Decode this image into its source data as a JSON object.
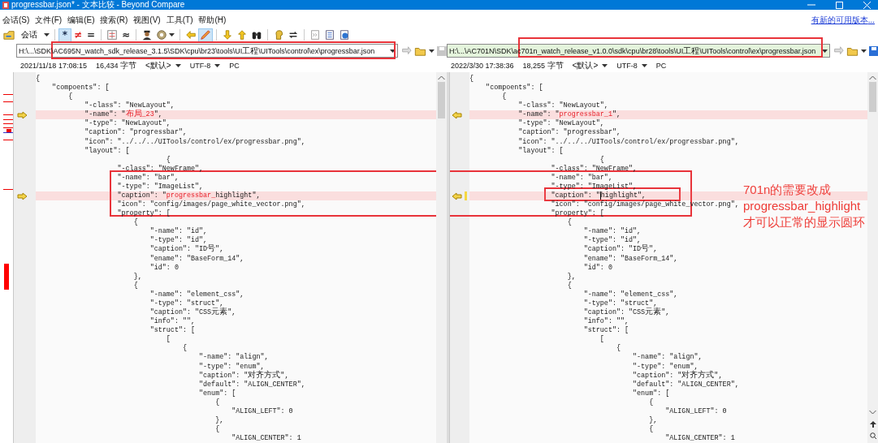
{
  "window": {
    "title": "progressbar.json* - 文本比较 - Beyond Compare"
  },
  "menu": [
    "会话(S)",
    "文件(F)",
    "编辑(E)",
    "搜索(R)",
    "视图(V)",
    "工具(T)",
    "帮助(H)"
  ],
  "update_link": "有新的可用版本...",
  "toolbar": {
    "groups": [
      [
        {
          "kind": "session",
          "label": "会话",
          "pressed": false
        }
      ],
      [
        {
          "kind": "glyph",
          "glyph": "*",
          "color": "#1a2a4a",
          "pressed": true
        },
        {
          "kind": "glyph",
          "glyph": "≠",
          "color": "#e02020",
          "pressed": false
        },
        {
          "kind": "glyph",
          "glyph": "=",
          "color": "#222222",
          "pressed": false
        }
      ],
      [
        {
          "kind": "icon",
          "pressed": false
        },
        {
          "kind": "glyph",
          "glyph": "≈",
          "color": "#222222",
          "pressed": false
        }
      ],
      [
        {
          "kind": "icon",
          "pressed": false
        },
        {
          "kind": "icon",
          "pressed": false
        }
      ],
      [
        {
          "kind": "icon",
          "pressed": false
        },
        {
          "kind": "icon",
          "pressed": true
        }
      ],
      [
        {
          "kind": "icon",
          "pressed": false
        },
        {
          "kind": "icon",
          "pressed": false
        },
        {
          "kind": "icon",
          "pressed": false
        }
      ],
      [
        {
          "kind": "icon",
          "pressed": false
        },
        {
          "kind": "icon",
          "pressed": false
        }
      ],
      [
        {
          "kind": "icon",
          "pressed": false
        },
        {
          "kind": "icon",
          "pressed": false
        },
        {
          "kind": "icon",
          "pressed": false
        }
      ]
    ]
  },
  "panes": [
    {
      "path": "H:\\...\\SDK\\AC695N_watch_sdk_release_3.1.5\\SDK\\cpu\\br23\\tools\\UI工程\\UITools\\control\\ex\\progressbar.json",
      "color": "#ffffff",
      "save_enabled": false,
      "modified": "2021/11/18 17:08:15",
      "size": "16,434 字节",
      "profile": "<默认>",
      "encoding": "UTF-8",
      "line_ending": "PC",
      "lines": [
        {
          "text": "{",
          "differs": false,
          "current": false
        },
        {
          "text": "    \"compoents\": [",
          "differs": false,
          "current": false
        },
        {
          "text": "        {",
          "differs": false,
          "current": false
        },
        {
          "text": "            \"-class\": \"NewLayout\",",
          "differs": false,
          "current": false
        },
        {
          "text": "            \"-name\": \"",
          "changed": "布局_23",
          "after": "\",",
          "differs": true,
          "current": false
        },
        {
          "text": "            \"-type\": \"NewLayout\",",
          "differs": false,
          "current": false
        },
        {
          "text": "            \"caption\": \"progressbar\",",
          "differs": false,
          "current": false
        },
        {
          "text": "            \"icon\": \"../../../UITools/control/ex/progressbar.png\",",
          "differs": false,
          "current": false
        },
        {
          "text": "            \"layout\": [",
          "differs": false,
          "current": false
        },
        {
          "text": "                                {",
          "differs": false,
          "current": false
        },
        {
          "text": "                    \"-class\": \"NewFrame\",",
          "differs": false,
          "current": false
        },
        {
          "text": "                    \"-name\": \"bar\",",
          "differs": false,
          "current": false
        },
        {
          "text": "                    \"-type\": \"ImageList\",",
          "differs": false,
          "current": false
        },
        {
          "text": "                    \"caption\": \"",
          "changed": "progressbar_",
          "after": "highlight\",",
          "differs": true,
          "current": false
        },
        {
          "text": "                    \"icon\": \"config/images/page_white_vector.png\",",
          "differs": false,
          "current": false
        },
        {
          "text": "                    \"property\": [",
          "differs": false,
          "current": false
        },
        {
          "text": "                        {",
          "differs": false,
          "current": false
        },
        {
          "text": "                            \"-name\": \"id\",",
          "differs": false,
          "current": false
        },
        {
          "text": "                            \"-type\": \"id\",",
          "differs": false,
          "current": false
        },
        {
          "text": "                            \"caption\": \"ID号\",",
          "differs": false,
          "current": false
        },
        {
          "text": "                            \"ename\": \"BaseForm_14\",",
          "differs": false,
          "current": false
        },
        {
          "text": "                            \"id\": 0",
          "differs": false,
          "current": false
        },
        {
          "text": "                        },",
          "differs": false,
          "current": false
        },
        {
          "text": "                        {",
          "differs": false,
          "current": false
        },
        {
          "text": "                            \"-name\": \"element_css\",",
          "differs": false,
          "current": false
        },
        {
          "text": "                            \"-type\": \"struct\",",
          "differs": false,
          "current": false
        },
        {
          "text": "                            \"caption\": \"CSS元素\",",
          "differs": false,
          "current": false
        },
        {
          "text": "                            \"info\": \"\",",
          "differs": false,
          "current": false
        },
        {
          "text": "                            \"struct\": [",
          "differs": false,
          "current": false
        },
        {
          "text": "                                [",
          "differs": false,
          "current": false
        },
        {
          "text": "                                    {",
          "differs": false,
          "current": false
        },
        {
          "text": "                                        \"-name\": \"align\",",
          "differs": false,
          "current": false
        },
        {
          "text": "                                        \"-type\": \"enum\",",
          "differs": false,
          "current": false
        },
        {
          "text": "                                        \"caption\": \"对齐方式\",",
          "differs": false,
          "current": false
        },
        {
          "text": "                                        \"default\": \"ALIGN_CENTER\",",
          "differs": false,
          "current": false
        },
        {
          "text": "                                        \"enum\": [",
          "differs": false,
          "current": false
        },
        {
          "text": "                                            {",
          "differs": false,
          "current": false
        },
        {
          "text": "                                                \"ALIGN_LEFT\": 0",
          "differs": false,
          "current": false
        },
        {
          "text": "                                            },",
          "differs": false,
          "current": false
        },
        {
          "text": "                                            {",
          "differs": false,
          "current": false
        },
        {
          "text": "                                                \"ALIGN_CENTER\": 1",
          "differs": false,
          "current": false
        }
      ]
    },
    {
      "path": "H:\\...\\AC701N\\SDK\\ac701n_watch_release_v1.0.0\\sdk\\cpu\\br28\\tools\\UI工程\\UITools\\control\\ex\\progressbar.json",
      "color": "#e4f4dc",
      "save_enabled": true,
      "modified": "2022/3/30 17:38:36",
      "size": "18,255 字节",
      "profile": "<默认>",
      "encoding": "UTF-8",
      "line_ending": "PC",
      "lines": [
        {
          "text": "{",
          "differs": false,
          "current": false
        },
        {
          "text": "    \"compoents\": [",
          "differs": false,
          "current": false
        },
        {
          "text": "        {",
          "differs": false,
          "current": false
        },
        {
          "text": "            \"-class\": \"NewLayout\",",
          "differs": false,
          "current": false
        },
        {
          "text": "            \"-name\": \"",
          "changed": "progressbar_1",
          "after": "\",",
          "differs": true,
          "current": false
        },
        {
          "text": "            \"-type\": \"NewLayout\",",
          "differs": false,
          "current": false
        },
        {
          "text": "            \"caption\": \"progressbar\",",
          "differs": false,
          "current": false
        },
        {
          "text": "            \"icon\": \"../../../UITools/control/ex/progressbar.png\",",
          "differs": false,
          "current": false
        },
        {
          "text": "            \"layout\": [",
          "differs": false,
          "current": false
        },
        {
          "text": "                                {",
          "differs": false,
          "current": false
        },
        {
          "text": "                    \"-class\": \"NewFrame\",",
          "differs": false,
          "current": false
        },
        {
          "text": "                    \"-name\": \"bar\",",
          "differs": false,
          "current": false
        },
        {
          "text": "                    \"-type\": \"ImageList\",",
          "differs": false,
          "current": false
        },
        {
          "text": "                    \"caption\": \"",
          "after": "highlight\",",
          "differs": true,
          "current": true
        },
        {
          "text": "                    \"icon\": \"config/images/page_white_vector.png\",",
          "differs": false,
          "current": false
        },
        {
          "text": "                    \"property\": [",
          "differs": false,
          "current": false
        },
        {
          "text": "                        {",
          "differs": false,
          "current": false
        },
        {
          "text": "                            \"-name\": \"id\",",
          "differs": false,
          "current": false
        },
        {
          "text": "                            \"-type\": \"id\",",
          "differs": false,
          "current": false
        },
        {
          "text": "                            \"caption\": \"ID号\",",
          "differs": false,
          "current": false
        },
        {
          "text": "                            \"ename\": \"BaseForm_14\",",
          "differs": false,
          "current": false
        },
        {
          "text": "                            \"id\": 0",
          "differs": false,
          "current": false
        },
        {
          "text": "                        },",
          "differs": false,
          "current": false
        },
        {
          "text": "                        {",
          "differs": false,
          "current": false
        },
        {
          "text": "                            \"-name\": \"element_css\",",
          "differs": false,
          "current": false
        },
        {
          "text": "                            \"-type\": \"struct\",",
          "differs": false,
          "current": false
        },
        {
          "text": "                            \"caption\": \"CSS元素\",",
          "differs": false,
          "current": false
        },
        {
          "text": "                            \"info\": \"\",",
          "differs": false,
          "current": false
        },
        {
          "text": "                            \"struct\": [",
          "differs": false,
          "current": false
        },
        {
          "text": "                                [",
          "differs": false,
          "current": false
        },
        {
          "text": "                                    {",
          "differs": false,
          "current": false
        },
        {
          "text": "                                        \"-name\": \"align\",",
          "differs": false,
          "current": false
        },
        {
          "text": "                                        \"-type\": \"enum\",",
          "differs": false,
          "current": false
        },
        {
          "text": "                                        \"caption\": \"对齐方式\",",
          "differs": false,
          "current": false
        },
        {
          "text": "                                        \"default\": \"ALIGN_CENTER\",",
          "differs": false,
          "current": false
        },
        {
          "text": "                                        \"enum\": [",
          "differs": false,
          "current": false
        },
        {
          "text": "                                            {",
          "differs": false,
          "current": false
        },
        {
          "text": "                                                \"ALIGN_LEFT\": 0",
          "differs": false,
          "current": false
        },
        {
          "text": "                                            },",
          "differs": false,
          "current": false
        },
        {
          "text": "                                            {",
          "differs": false,
          "current": false
        },
        {
          "text": "                                                \"ALIGN_CENTER\": 1",
          "differs": false,
          "current": false
        }
      ]
    }
  ],
  "annotation": {
    "lines": [
      "701n的需要改成",
      "progressbar_highlight",
      "才可以正常的显示圆环"
    ]
  }
}
